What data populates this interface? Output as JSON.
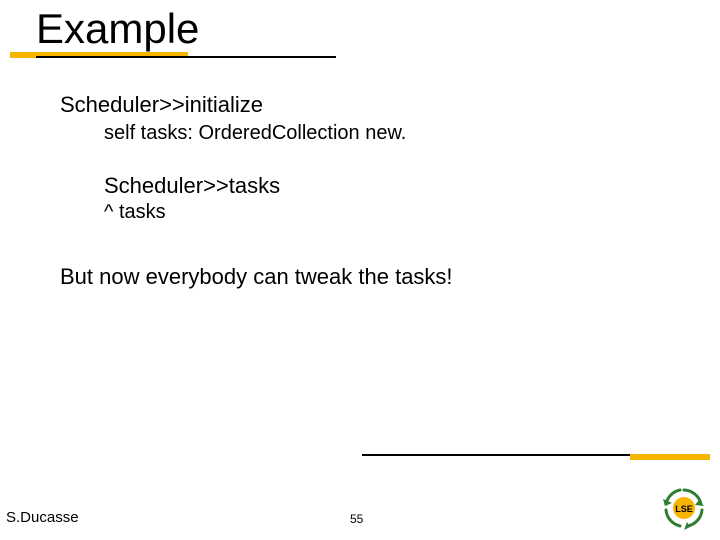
{
  "title": "Example",
  "body": {
    "line1": "Scheduler>>initialize",
    "line2": "self tasks: OrderedCollection new.",
    "line3": "Scheduler>>tasks",
    "line4": "^ tasks",
    "line5": "But now everybody can tweak the tasks!"
  },
  "footer": {
    "author": "S.Ducasse",
    "page": "55"
  },
  "icons": {
    "logo": "lse-recycle-logo"
  }
}
